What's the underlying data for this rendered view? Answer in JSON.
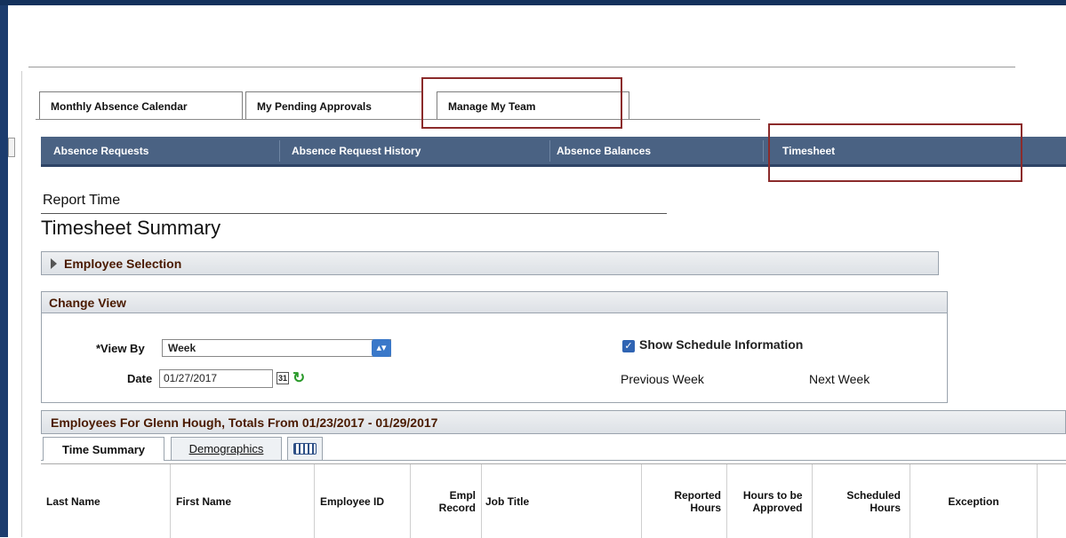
{
  "top_tabs": [
    {
      "label": "Monthly Absence Calendar"
    },
    {
      "label": "My Pending Approvals"
    },
    {
      "label": "Manage My Team"
    }
  ],
  "sub_nav": [
    {
      "label": "Absence Requests"
    },
    {
      "label": "Absence Request History"
    },
    {
      "label": "Absence Balances"
    },
    {
      "label": "Timesheet"
    }
  ],
  "page": {
    "report_time": "Report Time",
    "title": "Timesheet Summary"
  },
  "employee_selection": {
    "label": "Employee Selection"
  },
  "change_view": {
    "label": "Change View",
    "view_by_label": "*View By",
    "view_by_value": "Week",
    "date_label": "Date",
    "date_value": "01/27/2017",
    "show_schedule_label": "Show Schedule Information",
    "show_schedule_checked": true,
    "previous_week": "Previous Week",
    "next_week": "Next Week"
  },
  "employees": {
    "header": "Employees For Glenn Hough, Totals From 01/23/2017 - 01/29/2017",
    "tabs": [
      "Time Summary",
      "Demographics"
    ],
    "columns": [
      "Last Name",
      "First Name",
      "Employee ID",
      "Empl Record",
      "Job Title",
      "Reported Hours",
      "Hours to be Approved",
      "Scheduled Hours",
      "Exception"
    ]
  },
  "colors": {
    "nav_blue": "#4a6283",
    "highlight_red": "#8b2b2b",
    "section_title": "#4a1a00"
  }
}
